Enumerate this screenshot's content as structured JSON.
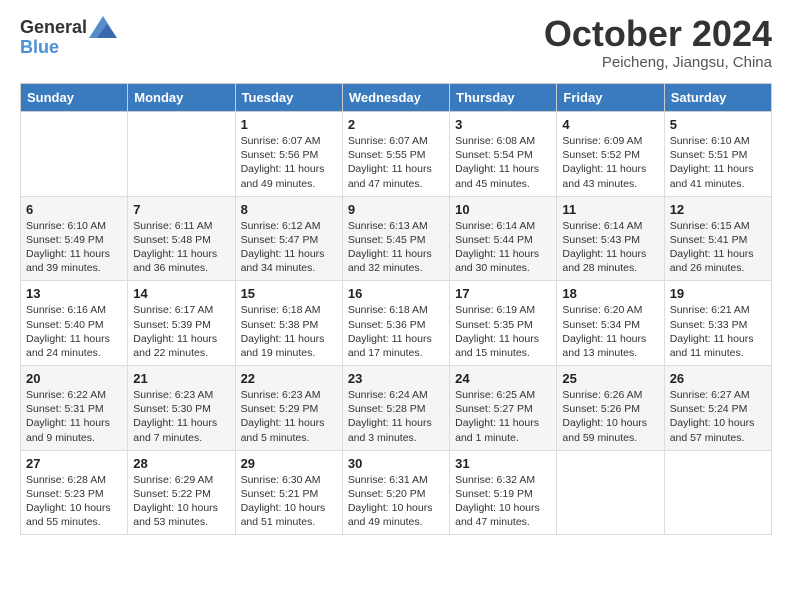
{
  "header": {
    "logo_general": "General",
    "logo_blue": "Blue",
    "month_title": "October 2024",
    "location": "Peicheng, Jiangsu, China"
  },
  "weekdays": [
    "Sunday",
    "Monday",
    "Tuesday",
    "Wednesday",
    "Thursday",
    "Friday",
    "Saturday"
  ],
  "weeks": [
    [
      {
        "day": "",
        "info": ""
      },
      {
        "day": "",
        "info": ""
      },
      {
        "day": "1",
        "info": "Sunrise: 6:07 AM\nSunset: 5:56 PM\nDaylight: 11 hours and 49 minutes."
      },
      {
        "day": "2",
        "info": "Sunrise: 6:07 AM\nSunset: 5:55 PM\nDaylight: 11 hours and 47 minutes."
      },
      {
        "day": "3",
        "info": "Sunrise: 6:08 AM\nSunset: 5:54 PM\nDaylight: 11 hours and 45 minutes."
      },
      {
        "day": "4",
        "info": "Sunrise: 6:09 AM\nSunset: 5:52 PM\nDaylight: 11 hours and 43 minutes."
      },
      {
        "day": "5",
        "info": "Sunrise: 6:10 AM\nSunset: 5:51 PM\nDaylight: 11 hours and 41 minutes."
      }
    ],
    [
      {
        "day": "6",
        "info": "Sunrise: 6:10 AM\nSunset: 5:49 PM\nDaylight: 11 hours and 39 minutes."
      },
      {
        "day": "7",
        "info": "Sunrise: 6:11 AM\nSunset: 5:48 PM\nDaylight: 11 hours and 36 minutes."
      },
      {
        "day": "8",
        "info": "Sunrise: 6:12 AM\nSunset: 5:47 PM\nDaylight: 11 hours and 34 minutes."
      },
      {
        "day": "9",
        "info": "Sunrise: 6:13 AM\nSunset: 5:45 PM\nDaylight: 11 hours and 32 minutes."
      },
      {
        "day": "10",
        "info": "Sunrise: 6:14 AM\nSunset: 5:44 PM\nDaylight: 11 hours and 30 minutes."
      },
      {
        "day": "11",
        "info": "Sunrise: 6:14 AM\nSunset: 5:43 PM\nDaylight: 11 hours and 28 minutes."
      },
      {
        "day": "12",
        "info": "Sunrise: 6:15 AM\nSunset: 5:41 PM\nDaylight: 11 hours and 26 minutes."
      }
    ],
    [
      {
        "day": "13",
        "info": "Sunrise: 6:16 AM\nSunset: 5:40 PM\nDaylight: 11 hours and 24 minutes."
      },
      {
        "day": "14",
        "info": "Sunrise: 6:17 AM\nSunset: 5:39 PM\nDaylight: 11 hours and 22 minutes."
      },
      {
        "day": "15",
        "info": "Sunrise: 6:18 AM\nSunset: 5:38 PM\nDaylight: 11 hours and 19 minutes."
      },
      {
        "day": "16",
        "info": "Sunrise: 6:18 AM\nSunset: 5:36 PM\nDaylight: 11 hours and 17 minutes."
      },
      {
        "day": "17",
        "info": "Sunrise: 6:19 AM\nSunset: 5:35 PM\nDaylight: 11 hours and 15 minutes."
      },
      {
        "day": "18",
        "info": "Sunrise: 6:20 AM\nSunset: 5:34 PM\nDaylight: 11 hours and 13 minutes."
      },
      {
        "day": "19",
        "info": "Sunrise: 6:21 AM\nSunset: 5:33 PM\nDaylight: 11 hours and 11 minutes."
      }
    ],
    [
      {
        "day": "20",
        "info": "Sunrise: 6:22 AM\nSunset: 5:31 PM\nDaylight: 11 hours and 9 minutes."
      },
      {
        "day": "21",
        "info": "Sunrise: 6:23 AM\nSunset: 5:30 PM\nDaylight: 11 hours and 7 minutes."
      },
      {
        "day": "22",
        "info": "Sunrise: 6:23 AM\nSunset: 5:29 PM\nDaylight: 11 hours and 5 minutes."
      },
      {
        "day": "23",
        "info": "Sunrise: 6:24 AM\nSunset: 5:28 PM\nDaylight: 11 hours and 3 minutes."
      },
      {
        "day": "24",
        "info": "Sunrise: 6:25 AM\nSunset: 5:27 PM\nDaylight: 11 hours and 1 minute."
      },
      {
        "day": "25",
        "info": "Sunrise: 6:26 AM\nSunset: 5:26 PM\nDaylight: 10 hours and 59 minutes."
      },
      {
        "day": "26",
        "info": "Sunrise: 6:27 AM\nSunset: 5:24 PM\nDaylight: 10 hours and 57 minutes."
      }
    ],
    [
      {
        "day": "27",
        "info": "Sunrise: 6:28 AM\nSunset: 5:23 PM\nDaylight: 10 hours and 55 minutes."
      },
      {
        "day": "28",
        "info": "Sunrise: 6:29 AM\nSunset: 5:22 PM\nDaylight: 10 hours and 53 minutes."
      },
      {
        "day": "29",
        "info": "Sunrise: 6:30 AM\nSunset: 5:21 PM\nDaylight: 10 hours and 51 minutes."
      },
      {
        "day": "30",
        "info": "Sunrise: 6:31 AM\nSunset: 5:20 PM\nDaylight: 10 hours and 49 minutes."
      },
      {
        "day": "31",
        "info": "Sunrise: 6:32 AM\nSunset: 5:19 PM\nDaylight: 10 hours and 47 minutes."
      },
      {
        "day": "",
        "info": ""
      },
      {
        "day": "",
        "info": ""
      }
    ]
  ]
}
